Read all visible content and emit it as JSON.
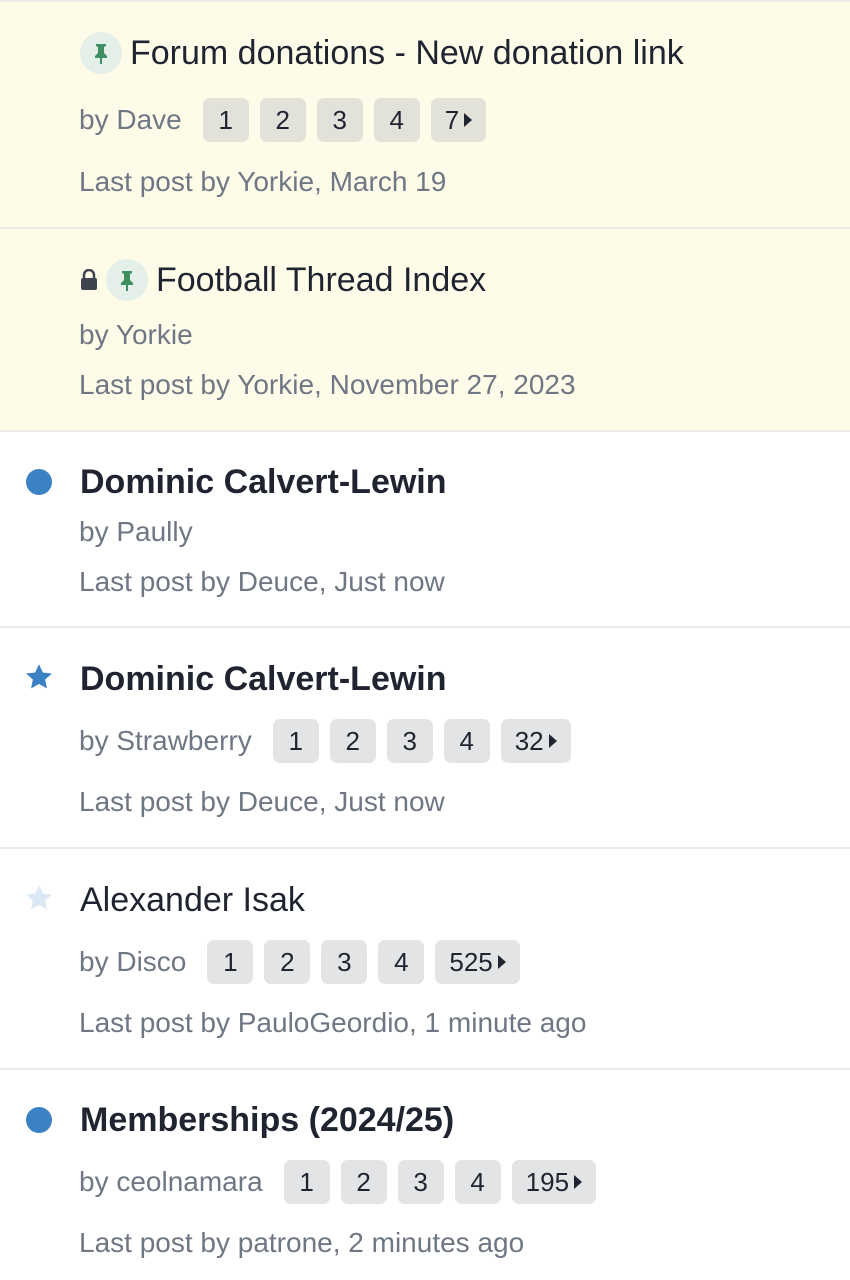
{
  "threads": [
    {
      "title": "Forum donations - New donation link",
      "author": "by Dave",
      "pages": [
        "1",
        "2",
        "3",
        "4",
        "7"
      ],
      "last_post": "Last post by Yorkie, March 19",
      "sticky": true,
      "pinned": true,
      "locked": false,
      "status_icon": "pin-icon"
    },
    {
      "title": "Football Thread Index",
      "author": "by Yorkie",
      "pages": [],
      "last_post": "Last post by Yorkie, November 27, 2023",
      "sticky": true,
      "pinned": true,
      "locked": true,
      "status_icon": "lock-icon"
    },
    {
      "title": "Dominic Calvert-Lewin",
      "author": "by Paully",
      "pages": [],
      "last_post": "Last post by Deuce, Just now",
      "unread": true,
      "status_icon": "unread-dot-icon"
    },
    {
      "title": "Dominic Calvert-Lewin",
      "author": "by Strawberry",
      "pages": [
        "1",
        "2",
        "3",
        "4",
        "32"
      ],
      "last_post": "Last post by Deuce, Just now",
      "unread": true,
      "status_icon": "star-icon"
    },
    {
      "title": "Alexander Isak",
      "author": "by Disco",
      "pages": [
        "1",
        "2",
        "3",
        "4",
        "525"
      ],
      "last_post": "Last post by PauloGeordio, 1 minute ago",
      "unread": false,
      "status_icon": "star-outline-icon"
    },
    {
      "title": "Memberships (2024/25)",
      "author": "by ceolnamara",
      "pages": [
        "1",
        "2",
        "3",
        "4",
        "195"
      ],
      "last_post": "Last post by patrone, 2 minutes ago",
      "unread": true,
      "status_icon": "unread-dot-icon"
    }
  ],
  "colors": {
    "sticky_bg": "#fefce9",
    "accent": "#3b82c4",
    "star_read": "#dbe9f6",
    "pin_green": "#3f8f62",
    "page_button_bg": "#e3e4e6",
    "meta_text": "#707784"
  }
}
